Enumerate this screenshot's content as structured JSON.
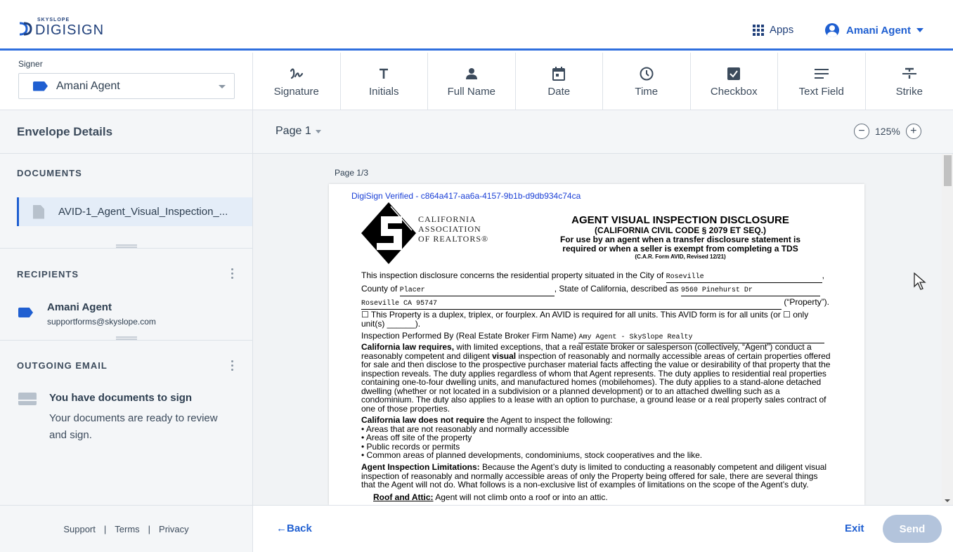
{
  "header": {
    "brand_small": "SKYSLOPE",
    "brand_big": "DIGISIGN",
    "apps_label": "Apps",
    "user_name": "Amani Agent"
  },
  "signer": {
    "label": "Signer",
    "selected": "Amani Agent"
  },
  "tools": [
    {
      "label": "Signature",
      "icon": "signature-icon"
    },
    {
      "label": "Initials",
      "icon": "initials-icon"
    },
    {
      "label": "Full Name",
      "icon": "person-icon"
    },
    {
      "label": "Date",
      "icon": "calendar-icon"
    },
    {
      "label": "Time",
      "icon": "clock-icon"
    },
    {
      "label": "Checkbox",
      "icon": "checkbox-icon"
    },
    {
      "label": "Text Field",
      "icon": "text-lines-icon"
    },
    {
      "label": "Strike",
      "icon": "strikethrough-icon"
    }
  ],
  "sidebar": {
    "title": "Envelope Details",
    "documents_title": "DOCUMENTS",
    "document_name": "AVID-1_Agent_Visual_Inspection_...",
    "recipients_title": "RECIPIENTS",
    "recipient_name": "Amani Agent",
    "recipient_email": "supportforms@skyslope.com",
    "outgoing_title": "OUTGOING EMAIL",
    "email_subject": "You have documents to sign",
    "email_body": "Your documents are ready to review and sign.",
    "footer_links": [
      "Support",
      "Terms",
      "Privacy"
    ]
  },
  "viewer": {
    "page_select": "Page 1",
    "zoom": "125%",
    "zoom_out": "−",
    "zoom_in": "+",
    "page_label": "Page 1/3"
  },
  "document": {
    "verified": "DigiSign Verified - c864a417-aa6a-4157-9b1b-d9db934c74ca",
    "org_lines": [
      "CALIFORNIA",
      "ASSOCIATION",
      "OF REALTORS®"
    ],
    "title": "AGENT VISUAL INSPECTION DISCLOSURE",
    "subtitle": "(CALIFORNIA CIVIL CODE § 2079 ET SEQ.)",
    "subtitle2": "For use by an agent when a transfer disclosure statement is",
    "subtitle3": "required or when a seller is exempt from completing a TDS",
    "form_rev": "(C.A.R. Form AVID, Revised 12/21)",
    "line1_pre": "This inspection disclosure concerns the residential property situated in the City of",
    "city": "Roseville",
    "county_pre": "County of",
    "county": "Placer",
    "state_pre": ", State of California, described as",
    "address": "9560 Pinehurst Dr",
    "address2": "Roseville CA 95747",
    "property_suffix": "(“Property”).",
    "duplex": "☐ This Property is a duplex, triplex, or fourplex.  An AVID is required for all units.  This AVID form is for all units (or ☐ only unit(s) ______).",
    "inspection_pre": "Inspection Performed By (Real Estate Broker Firm Name)",
    "firm": "Amy Agent - SkySlope Realty",
    "law_requires_bold": "California law requires,",
    "law_requires_text_a": " with limited exceptions, that a real estate broker or salesperson (collectively, “Agent”) conduct a reasonably competent and diligent ",
    "law_visual": "visual",
    "law_requires_text_b": " inspection of reasonably and normally accessible areas of certain properties offered for sale and then disclose to the prospective purchaser material facts affecting the value or desirability of that property that the inspection reveals.  The duty applies regardless of whom that Agent represents.  The duty applies to residential real properties containing one-to-four dwelling units, and manufactured homes (mobilehomes).  The duty applies to a stand-alone detached dwelling (whether or not located in a subdivision or a planned development) or to an attached dwelling such as a condominium.  The duty also applies to a lease with an option to purchase, a ground lease or a real property sales contract of one of those properties.",
    "not_require_bold": "California law does not require",
    "not_require_text": " the Agent to inspect the following:",
    "bullets": [
      "• Areas that are not reasonably and normally accessible",
      "• Areas off site of the property",
      "• Public records or permits",
      "• Common areas of planned developments, condominiums, stock cooperatives and the like."
    ],
    "limitations_bold": "Agent Inspection Limitations:",
    "limitations_text": " Because the Agent’s duty is limited to conducting a reasonably competent and diligent visual inspection of reasonably and normally accessible areas of only the Property being offered for sale, there are several things that the Agent will not do. What follows is a non-exclusive list of examples of limitations on the scope of the Agent’s duty.",
    "roof_bold": "Roof and Attic:",
    "roof_text": " Agent will not climb onto a roof or into an attic."
  },
  "footer": {
    "back_label": "Back",
    "exit_label": "Exit",
    "send_label": "Send"
  }
}
